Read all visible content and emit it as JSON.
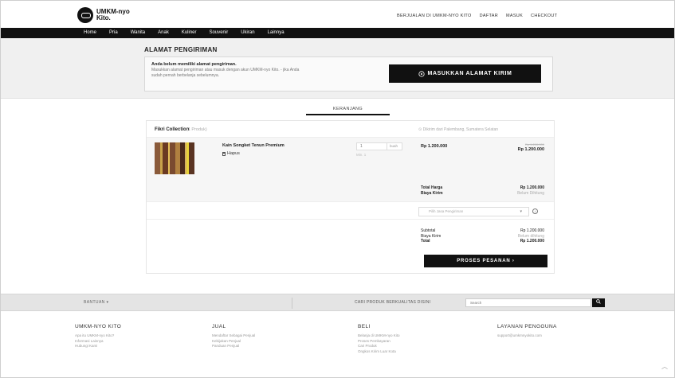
{
  "header": {
    "logo_text": "UMKM-nyo Kito.",
    "links": [
      "BERJUALAN DI UMKM-NYO KITO",
      "DAFTAR",
      "MASUK",
      "CHECKOUT"
    ]
  },
  "nav": [
    "Home",
    "Pria",
    "Wanita",
    "Anak",
    "Kuliner",
    "Souvenir",
    "Ukiran",
    "Lainnya"
  ],
  "address": {
    "title": "ALAMAT PENGIRIMAN",
    "heading": "Anda belum memiliki alamat pengiriman.",
    "description": "Masukkan alamat pengiriman atau masuk dengan akun UMKM-nyo Kito. - jika Anda sudah pernah berbelanja sebelumnya.",
    "button_label": "MASUKKAN ALAMAT KIRIM"
  },
  "tab": {
    "label": "KERANJANG"
  },
  "cart": {
    "shop_name": "Fikri Collection",
    "shop_count": "(1 Produk)",
    "ship_from": "Dikirim dari Palembang, Sumatera Selatan",
    "item": {
      "name": "Kain Songket Tenun Premium",
      "delete_label": "Hapus",
      "qty": "1",
      "unit": "buah",
      "min": "Min. 1",
      "price": "Rp 1.200.000",
      "price_strike": "Rp 1.200.000",
      "price_right": "Rp 1.200.000"
    },
    "totals": {
      "total_label": "Total Harga",
      "total_value": "Rp 1.200.000",
      "ship_label": "Biaya Kirim",
      "ship_value": "Belum Dihitung"
    },
    "shipping_select": {
      "placeholder": "Pilih Jasa Pengiriman"
    },
    "summary": {
      "subtotal_label": "Subtotal",
      "subtotal_value": "Rp 1.200.000",
      "ship_label": "Biaya Kirim",
      "ship_value": "Belum dihitung",
      "total_label": "Total",
      "total_value": "Rp 1.200.000"
    },
    "order_button": "PROSES PESANAN ›"
  },
  "footer": {
    "help": "BANTUAN",
    "search_label": "CARI PRODUK BERKUALITAS DISINI",
    "search_placeholder": "Search",
    "columns": [
      {
        "title": "UMKM-NYO KITO",
        "links": [
          "Apa itu UMKM-nyo Kito?",
          "Informasi Lainnya",
          "Hubungi Kami"
        ]
      },
      {
        "title": "JUAL",
        "links": [
          "Mendaftar Sebagai Penjual",
          "Kebijakan Penjual",
          "Panduan Penjual"
        ]
      },
      {
        "title": "BELI",
        "links": [
          "Belanja di UMKM-nyo Kito",
          "Proses Pembayaran",
          "Cari Produk",
          "Ongkos Kirim Luar Kota"
        ]
      },
      {
        "title": "LAYANAN PENGGUNA",
        "links": [
          "support@umkmnyokito.com"
        ]
      }
    ]
  }
}
